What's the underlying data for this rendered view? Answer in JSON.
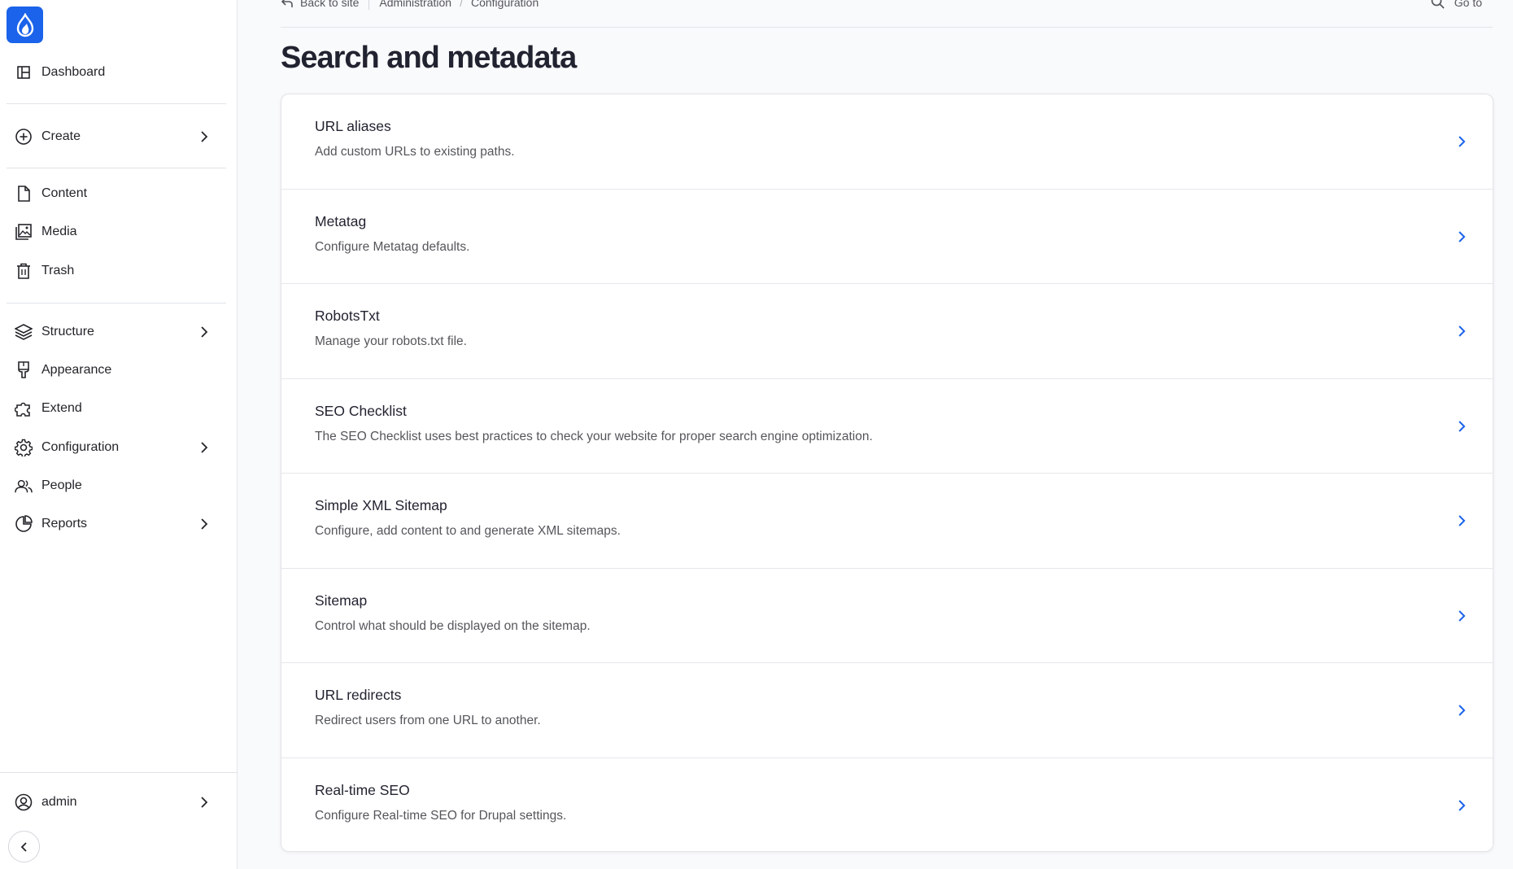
{
  "sidebar": {
    "items": [
      {
        "label": "Dashboard",
        "icon": "dashboard-icon"
      },
      {
        "label": "Create",
        "icon": "plus-circle-icon"
      },
      {
        "label": "Content",
        "icon": "document-icon"
      },
      {
        "label": "Media",
        "icon": "image-icon"
      },
      {
        "label": "Trash",
        "icon": "trash-icon"
      },
      {
        "label": "Structure",
        "icon": "layers-icon"
      },
      {
        "label": "Appearance",
        "icon": "brush-icon"
      },
      {
        "label": "Extend",
        "icon": "puzzle-icon"
      },
      {
        "label": "Configuration",
        "icon": "gear-icon"
      },
      {
        "label": "People",
        "icon": "people-icon"
      },
      {
        "label": "Reports",
        "icon": "pie-chart-icon"
      }
    ],
    "user": {
      "label": "admin",
      "icon": "user-circle-icon"
    }
  },
  "breadcrumb": {
    "back": "Back to site",
    "items": [
      "Administration",
      "Configuration"
    ]
  },
  "goto": {
    "label": "Go to"
  },
  "page": {
    "title": "Search and metadata"
  },
  "rows": [
    {
      "title": "URL aliases",
      "description": "Add custom URLs to existing paths."
    },
    {
      "title": "Metatag",
      "description": "Configure Metatag defaults."
    },
    {
      "title": "RobotsTxt",
      "description": "Manage your robots.txt file."
    },
    {
      "title": "SEO Checklist",
      "description": "The SEO Checklist uses best practices to check your website for proper search engine optimization."
    },
    {
      "title": "Simple XML Sitemap",
      "description": "Configure, add content to and generate XML sitemaps."
    },
    {
      "title": "Sitemap",
      "description": "Control what should be displayed on the sitemap."
    },
    {
      "title": "URL redirects",
      "description": "Redirect users from one URL to another."
    },
    {
      "title": "Real-time SEO",
      "description": "Configure Real-time SEO for Drupal settings."
    }
  ],
  "colors": {
    "accent": "#1a63ea",
    "text": "#222330",
    "muted": "#55565b"
  }
}
